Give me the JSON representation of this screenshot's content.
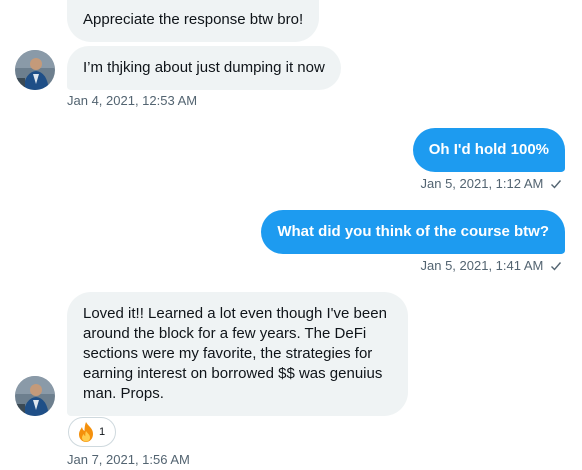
{
  "messages": [
    {
      "text": "Appreciate the response btw bro!"
    },
    {
      "text": "I’m thjking about just dumping it now",
      "timestamp": "Jan 4, 2021, 12:53 AM"
    },
    {
      "text": "Oh I'd hold 100%",
      "timestamp": "Jan 5, 2021, 1:12 AM"
    },
    {
      "text": "What did you think of the course btw?",
      "timestamp": "Jan 5, 2021, 1:41 AM"
    },
    {
      "text": "Loved it!! Learned a lot even though I've been around the block for a few years. The DeFi sections were my favorite, the strategies for earning interest on borrowed $$ was genuius man. Props.",
      "timestamp": "Jan 7, 2021, 1:56 AM"
    }
  ],
  "reaction": {
    "icon": "fire-emoji-icon",
    "count": "1"
  },
  "colors": {
    "incoming_bubble": "#eff3f4",
    "outgoing_bubble": "#1d9bf0",
    "meta_text": "#536471"
  }
}
